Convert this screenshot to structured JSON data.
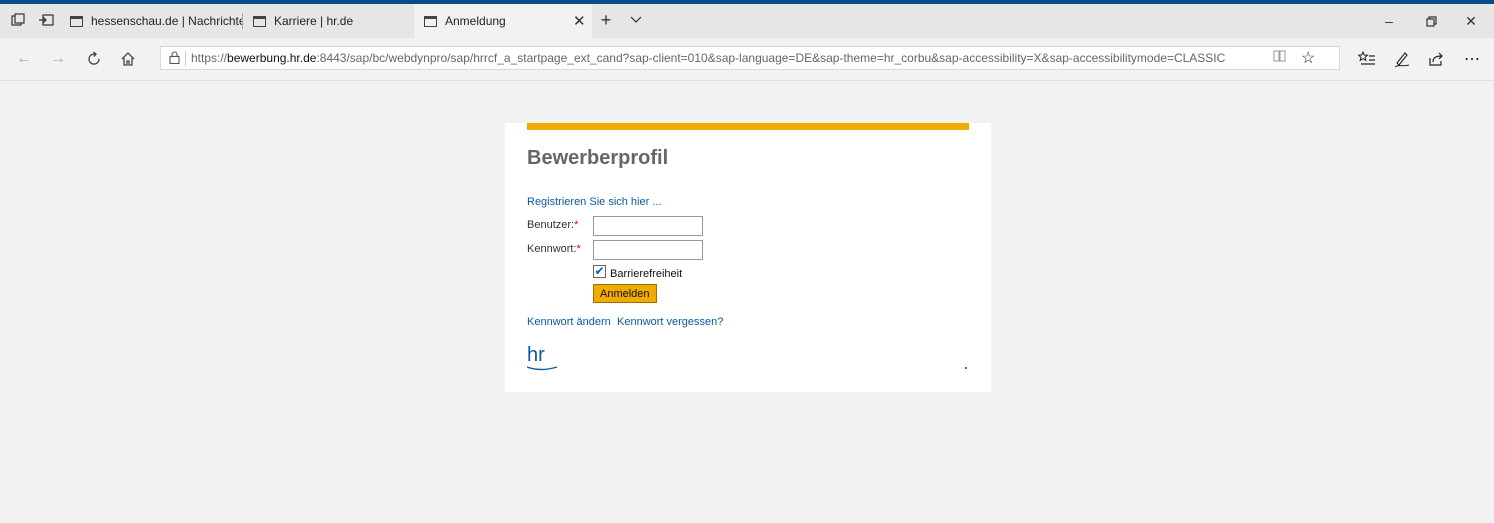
{
  "browser": {
    "tabs": [
      {
        "label": "hessenschau.de | Nachrichte"
      },
      {
        "label": "Karriere | hr.de"
      },
      {
        "label": "Anmeldung"
      }
    ],
    "url_prefix": "https://",
    "url_host": "bewerbung.hr.de",
    "url_rest": ":8443/sap/bc/webdynpro/sap/hrrcf_a_startpage_ext_cand?sap-client=010&sap-language=DE&sap-theme=hr_corbu&sap-accessibility=X&sap-accessibilitymode=CLASSIC",
    "icons": {
      "tab_actions": "tab-actions-icon",
      "set_aside": "set-aside-tabs-icon",
      "close_tab": "close-icon",
      "new_tab": "plus-icon",
      "tab_preview": "chevron-down-icon",
      "back": "back-arrow-icon",
      "forward": "forward-arrow-icon",
      "refresh": "refresh-icon",
      "home": "home-icon",
      "lock": "lock-icon",
      "reading_view": "reading-view-icon",
      "favorite": "star-icon",
      "favorites_hub": "favorites-list-icon",
      "notes": "pen-icon",
      "share": "share-icon",
      "more": "more-icon",
      "minimize": "minimize-icon",
      "restore": "restore-icon",
      "close_window": "close-window-icon"
    }
  },
  "page": {
    "title": "Bewerberprofil",
    "register_link": "Registrieren Sie sich hier ...",
    "user_label": "Benutzer:",
    "password_label": "Kennwort:",
    "required_mark": "*",
    "user_value": "",
    "password_value": "",
    "accessibility_label": "Barrierefreiheit",
    "accessibility_checked": true,
    "login_button": "Anmelden",
    "change_password": "Kennwort ändern",
    "forgot_password": "Kennwort vergessen?",
    "logo_text": "hr",
    "accent_color": "#f0ab00",
    "link_color": "#0a5aa0"
  }
}
